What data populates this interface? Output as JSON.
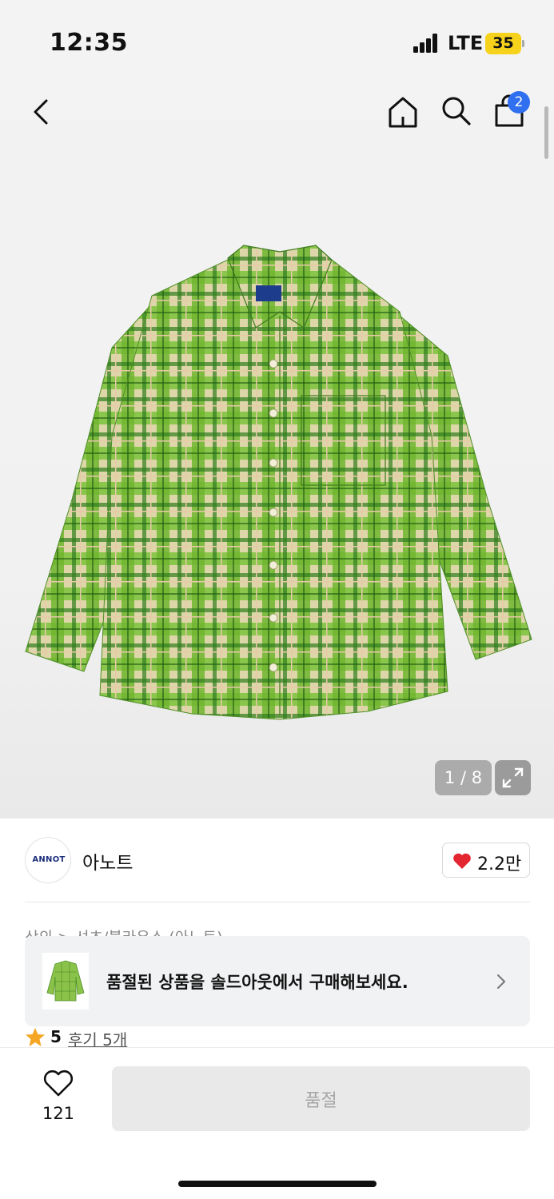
{
  "status_bar": {
    "time": "12:35",
    "network": "LTE",
    "battery": "35"
  },
  "header": {
    "cart_count": "2"
  },
  "gallery": {
    "counter": "1 / 8"
  },
  "brand": {
    "logo_text": "ANNOT",
    "name": "아노트",
    "likes": "2.2만"
  },
  "breadcrumb": "상의 > 셔츠/블라우스 (아노트)",
  "soldout_banner": {
    "text": "품절된 상품을 솔드아웃에서 구매해보세요."
  },
  "rating": {
    "score": "5",
    "reviews": "후기 5개"
  },
  "bottom": {
    "wish_count": "121",
    "buy_label": "품절"
  },
  "colors": {
    "accent": "#2f6ff0",
    "heart": "#e3262f",
    "star": "#f5a623",
    "battery": "#f7d21c"
  }
}
